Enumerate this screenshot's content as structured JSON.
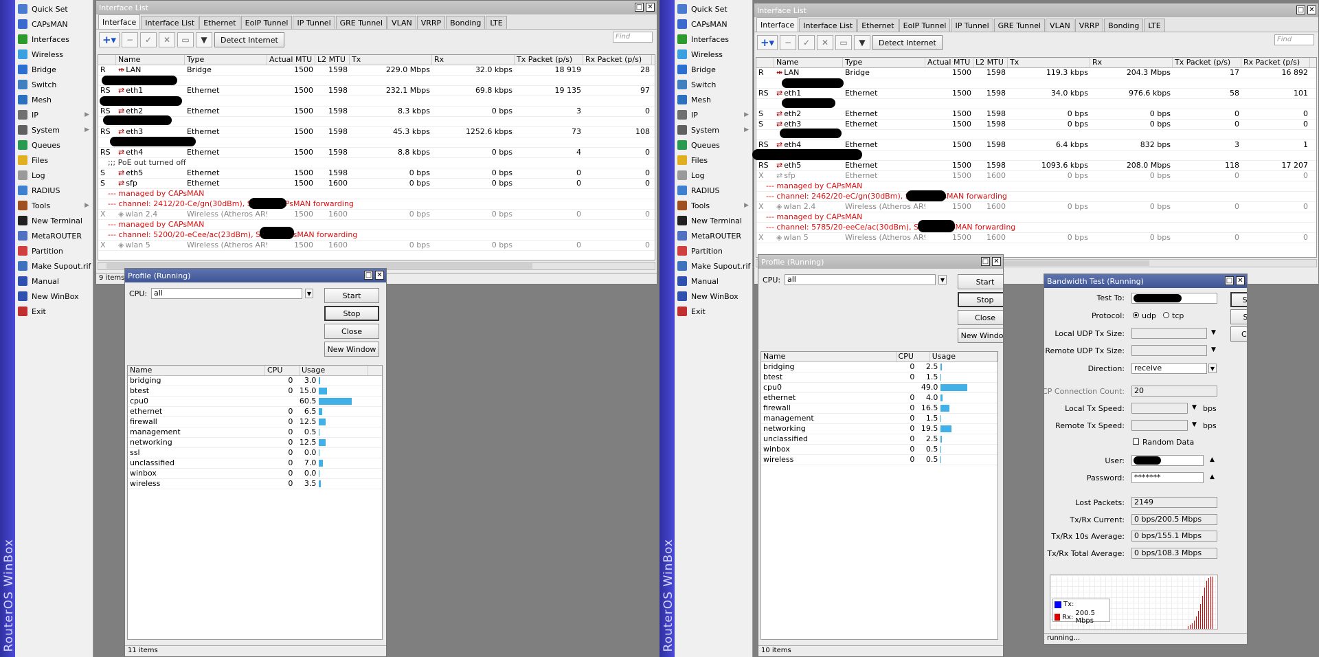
{
  "brand": "RouterOS WinBox",
  "menu": [
    {
      "label": "Quick Set",
      "icon": "quickset-icon",
      "color": "#4a7bd0"
    },
    {
      "label": "CAPsMAN",
      "icon": "capsman-icon",
      "color": "#3a6ad0"
    },
    {
      "label": "Interfaces",
      "icon": "interfaces-icon",
      "color": "#2c9a2c"
    },
    {
      "label": "Wireless",
      "icon": "wireless-icon",
      "color": "#3aa0e0"
    },
    {
      "label": "Bridge",
      "icon": "bridge-icon",
      "color": "#2c6fd0"
    },
    {
      "label": "Switch",
      "icon": "switch-icon",
      "color": "#4080c0"
    },
    {
      "label": "Mesh",
      "icon": "mesh-icon",
      "color": "#2c70c0"
    },
    {
      "label": "IP",
      "icon": "ip-icon",
      "color": "#707070",
      "sub": true
    },
    {
      "label": "System",
      "icon": "system-icon",
      "color": "#606060",
      "sub": true
    },
    {
      "label": "Queues",
      "icon": "queues-icon",
      "color": "#2a9a50"
    },
    {
      "label": "Files",
      "icon": "files-icon",
      "color": "#e0b020"
    },
    {
      "label": "Log",
      "icon": "log-icon",
      "color": "#9a9a9a"
    },
    {
      "label": "RADIUS",
      "icon": "radius-icon",
      "color": "#4080d0"
    },
    {
      "label": "Tools",
      "icon": "tools-icon",
      "color": "#a05020",
      "sub": true
    },
    {
      "label": "New Terminal",
      "icon": "terminal-icon",
      "color": "#202020"
    },
    {
      "label": "MetaROUTER",
      "icon": "metarouter-icon",
      "color": "#5070c0"
    },
    {
      "label": "Partition",
      "icon": "partition-icon",
      "color": "#d04040"
    },
    {
      "label": "Make Supout.rif",
      "icon": "supout-icon",
      "color": "#4070c0"
    },
    {
      "label": "Manual",
      "icon": "manual-icon",
      "color": "#3050b0"
    },
    {
      "label": "New WinBox",
      "icon": "winbox-icon",
      "color": "#3050b0"
    },
    {
      "label": "Exit",
      "icon": "exit-icon",
      "color": "#c03030"
    }
  ],
  "iface": {
    "title": "Interface List",
    "tabs": [
      "Interface",
      "Interface List",
      "Ethernet",
      "EoIP Tunnel",
      "IP Tunnel",
      "GRE Tunnel",
      "VLAN",
      "VRRP",
      "Bonding",
      "LTE"
    ],
    "detect": "Detect Internet",
    "find": "Find",
    "cols": [
      "",
      "Name",
      "Type",
      "Actual MTU",
      "L2 MTU",
      "Tx",
      "Rx",
      "Tx Packet (p/s)",
      "Rx Packet (p/s)"
    ]
  },
  "left": {
    "status": "9 items",
    "rows": [
      {
        "k": "row",
        "f": "R",
        "n": "LAN",
        "t": "Bridge",
        "m": "1500",
        "l": "1598",
        "tx": "229.0 Mbps",
        "rx": "32.0 kbps",
        "tp": "18 919",
        "rp": "28"
      },
      {
        "k": "blank"
      },
      {
        "k": "row",
        "f": "RS",
        "n": "eth1",
        "t": "Ethernet",
        "m": "1500",
        "l": "1598",
        "tx": "232.1 Mbps",
        "rx": "69.8 kbps",
        "tp": "19 135",
        "rp": "97"
      },
      {
        "k": "blank"
      },
      {
        "k": "row",
        "f": "RS",
        "n": "eth2",
        "t": "Ethernet",
        "m": "1500",
        "l": "1598",
        "tx": "8.3 kbps",
        "rx": "0 bps",
        "tp": "3",
        "rp": "0"
      },
      {
        "k": "blank"
      },
      {
        "k": "row",
        "f": "RS",
        "n": "eth3",
        "t": "Ethernet",
        "m": "1500",
        "l": "1598",
        "tx": "45.3 kbps",
        "rx": "1252.6 kbps",
        "tp": "73",
        "rp": "108"
      },
      {
        "k": "blank"
      },
      {
        "k": "row",
        "f": "RS",
        "n": "eth4",
        "t": "Ethernet",
        "m": "1500",
        "l": "1598",
        "tx": "8.8 kbps",
        "rx": "0 bps",
        "tp": "4",
        "rp": "0"
      },
      {
        "k": "note",
        "c": ";;; PoE out turned off"
      },
      {
        "k": "row",
        "f": "S",
        "n": "eth5",
        "t": "Ethernet",
        "m": "1500",
        "l": "1598",
        "tx": "0 bps",
        "rx": "0 bps",
        "tp": "0",
        "rp": "0"
      },
      {
        "k": "row",
        "f": "S",
        "n": "sfp",
        "t": "Ethernet",
        "m": "1500",
        "l": "1600",
        "tx": "0 bps",
        "rx": "0 bps",
        "tp": "0",
        "rp": "0"
      },
      {
        "k": "comment",
        "c": "--- managed by CAPsMAN"
      },
      {
        "k": "comment",
        "c": "--- channel: 2412/20-Ce/gn(30dBm), SSID:              , CAPsMAN forwarding"
      },
      {
        "k": "dis",
        "f": "X",
        "n": "wlan 2.4",
        "t": "Wireless (Atheros AR9...",
        "m": "1500",
        "l": "1600",
        "tx": "0 bps",
        "rx": "0 bps",
        "tp": "0",
        "rp": "0"
      },
      {
        "k": "comment",
        "c": "--- managed by CAPsMAN"
      },
      {
        "k": "comment",
        "c": "--- channel: 5200/20-eCee/ac(23dBm), SSID:              CAPsMAN forwarding"
      },
      {
        "k": "dis",
        "f": "X",
        "n": "wlan 5",
        "t": "Wireless (Atheros AR9...",
        "m": "1500",
        "l": "1600",
        "tx": "0 bps",
        "rx": "0 bps",
        "tp": "0",
        "rp": "0"
      }
    ]
  },
  "right": {
    "rows": [
      {
        "k": "row",
        "f": "R",
        "n": "LAN",
        "t": "Bridge",
        "m": "1500",
        "l": "1598",
        "tx": "119.3 kbps",
        "rx": "204.3 Mbps",
        "tp": "17",
        "rp": "16 892"
      },
      {
        "k": "blank"
      },
      {
        "k": "row",
        "f": "RS",
        "n": "eth1",
        "t": "Ethernet",
        "m": "1500",
        "l": "1598",
        "tx": "34.0 kbps",
        "rx": "976.6 kbps",
        "tp": "58",
        "rp": "101"
      },
      {
        "k": "blank"
      },
      {
        "k": "row",
        "f": "S",
        "n": "eth2",
        "t": "Ethernet",
        "m": "1500",
        "l": "1598",
        "tx": "0 bps",
        "rx": "0 bps",
        "tp": "0",
        "rp": "0"
      },
      {
        "k": "row",
        "f": "S",
        "n": "eth3",
        "t": "Ethernet",
        "m": "1500",
        "l": "1598",
        "tx": "0 bps",
        "rx": "0 bps",
        "tp": "0",
        "rp": "0"
      },
      {
        "k": "blank"
      },
      {
        "k": "row",
        "f": "RS",
        "n": "eth4",
        "t": "Ethernet",
        "m": "1500",
        "l": "1598",
        "tx": "6.4 kbps",
        "rx": "832 bps",
        "tp": "3",
        "rp": "1"
      },
      {
        "k": "blank"
      },
      {
        "k": "row",
        "f": "RS",
        "n": "eth5",
        "t": "Ethernet",
        "m": "1500",
        "l": "1598",
        "tx": "1093.6 kbps",
        "rx": "208.0 Mbps",
        "tp": "118",
        "rp": "17 207"
      },
      {
        "k": "dis",
        "f": "X",
        "n": "sfp",
        "t": "Ethernet",
        "m": "1500",
        "l": "1600",
        "tx": "0 bps",
        "rx": "0 bps",
        "tp": "0",
        "rp": "0"
      },
      {
        "k": "comment",
        "c": "--- managed by CAPsMAN"
      },
      {
        "k": "comment",
        "c": "--- channel: 2462/20-eC/gn(30dBm), SSID:              CAPsMAN forwarding"
      },
      {
        "k": "dis",
        "f": "X",
        "n": "wlan 2.4",
        "t": "Wireless (Atheros AR9...",
        "m": "1500",
        "l": "1600",
        "tx": "0 bps",
        "rx": "0 bps",
        "tp": "0",
        "rp": "0"
      },
      {
        "k": "comment",
        "c": "--- managed by CAPsMAN"
      },
      {
        "k": "comment",
        "c": "--- channel: 5785/20-eeCe/ac(30dBm), SSID:              CAPsMAN forwarding"
      },
      {
        "k": "dis",
        "f": "X",
        "n": "wlan 5",
        "t": "Wireless (Atheros AR9...",
        "m": "1500",
        "l": "1600",
        "tx": "0 bps",
        "rx": "0 bps",
        "tp": "0",
        "rp": "0"
      }
    ]
  },
  "profile": {
    "title": "Profile (Running)",
    "cpu_label": "CPU:",
    "cpu_value": "all",
    "buttons": [
      "Start",
      "Stop",
      "Close",
      "New Window"
    ],
    "cols": [
      "Name",
      "CPU",
      "Usage"
    ],
    "left_status": "11 items",
    "right_status": "10 items",
    "left_rows": [
      {
        "n": "bridging",
        "c": "0",
        "u": "3.0",
        "p": 3.0
      },
      {
        "n": "btest",
        "c": "0",
        "u": "15.0",
        "p": 15.0
      },
      {
        "n": "cpu0",
        "c": "",
        "u": "60.5",
        "p": 60.5
      },
      {
        "n": "ethernet",
        "c": "0",
        "u": "6.5",
        "p": 6.5
      },
      {
        "n": "firewall",
        "c": "0",
        "u": "12.5",
        "p": 12.5
      },
      {
        "n": "management",
        "c": "0",
        "u": "0.5",
        "p": 0.5
      },
      {
        "n": "networking",
        "c": "0",
        "u": "12.5",
        "p": 12.5
      },
      {
        "n": "ssl",
        "c": "0",
        "u": "0.0",
        "p": 0.0
      },
      {
        "n": "unclassified",
        "c": "0",
        "u": "7.0",
        "p": 7.0
      },
      {
        "n": "winbox",
        "c": "0",
        "u": "0.0",
        "p": 0.0
      },
      {
        "n": "wireless",
        "c": "0",
        "u": "3.5",
        "p": 3.5
      }
    ],
    "right_rows": [
      {
        "n": "bridging",
        "c": "0",
        "u": "2.5",
        "p": 2.5
      },
      {
        "n": "btest",
        "c": "0",
        "u": "1.5",
        "p": 1.5
      },
      {
        "n": "cpu0",
        "c": "",
        "u": "49.0",
        "p": 49.0
      },
      {
        "n": "ethernet",
        "c": "0",
        "u": "4.0",
        "p": 4.0
      },
      {
        "n": "firewall",
        "c": "0",
        "u": "16.5",
        "p": 16.5
      },
      {
        "n": "management",
        "c": "0",
        "u": "1.5",
        "p": 1.5
      },
      {
        "n": "networking",
        "c": "0",
        "u": "19.5",
        "p": 19.5
      },
      {
        "n": "unclassified",
        "c": "0",
        "u": "2.5",
        "p": 2.5
      },
      {
        "n": "winbox",
        "c": "0",
        "u": "0.5",
        "p": 0.5
      },
      {
        "n": "wireless",
        "c": "0",
        "u": "0.5",
        "p": 0.5
      }
    ]
  },
  "btest": {
    "title": "Bandwidth Test (Running)",
    "test_to": "Test To:",
    "protocol": "Protocol:",
    "udp": "udp",
    "tcp": "tcp",
    "local_udp": "Local UDP Tx Size:",
    "remote_udp": "Remote UDP Tx Size:",
    "direction": "Direction:",
    "direction_value": "receive",
    "tcp_count": "TCP Connection Count:",
    "tcp_count_value": "20",
    "local_speed": "Local Tx Speed:",
    "remote_speed": "Remote Tx Speed:",
    "bps": "bps",
    "random": "Random Data",
    "user": "User:",
    "password": "Password:",
    "password_value": "*******",
    "lost": "Lost Packets:",
    "lost_value": "2149",
    "current": "Tx/Rx Current:",
    "current_value": "0 bps/200.5 Mbps",
    "avg10": "Tx/Rx 10s Average:",
    "avg10_value": "0 bps/155.1 Mbps",
    "total": "Tx/Rx Total Average:",
    "total_value": "0 bps/108.3 Mbps",
    "buttons": [
      "Start",
      "Stop",
      "Close"
    ],
    "legend_tx": "Tx:",
    "legend_rx": "Rx:",
    "legend_rx_value": "200.5 Mbps",
    "status": "running...",
    "tx_color": "#0000ff",
    "rx_color": "#e00000"
  }
}
